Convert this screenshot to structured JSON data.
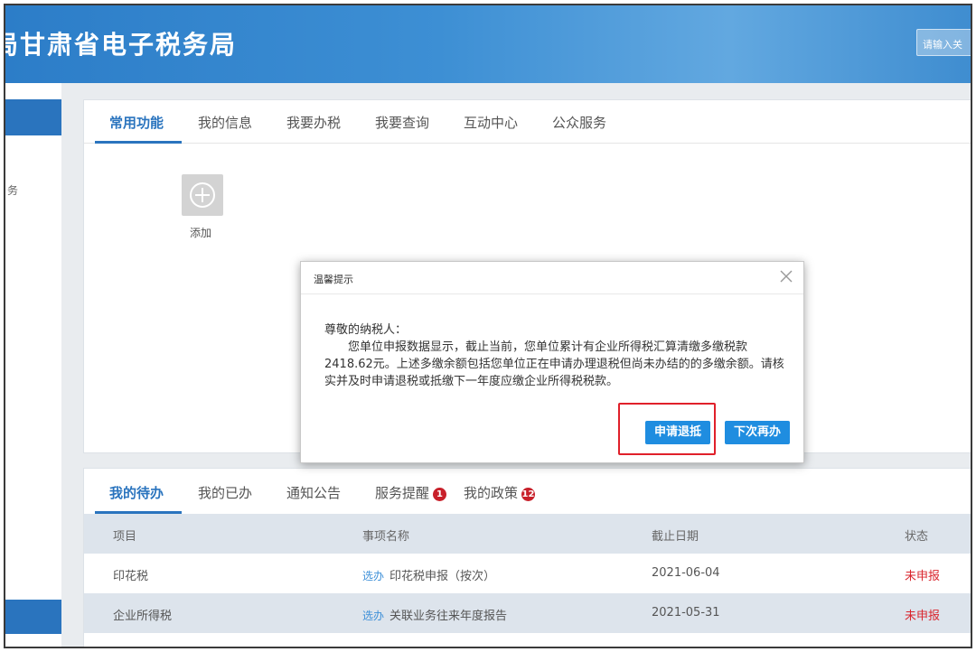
{
  "header": {
    "title": "局甘肃省电子税务局",
    "search_placeholder": "请输入关"
  },
  "sidebar": {
    "glyph": "务"
  },
  "top_tabs": [
    {
      "label": "常用功能",
      "active": true
    },
    {
      "label": "我的信息",
      "active": false
    },
    {
      "label": "我要办税",
      "active": false
    },
    {
      "label": "我要查询",
      "active": false
    },
    {
      "label": "互动中心",
      "active": false
    },
    {
      "label": "公众服务",
      "active": false
    }
  ],
  "quick_add": {
    "label": "添加",
    "icon": "plus-circle-icon"
  },
  "bottom_tabs": [
    {
      "label": "我的待办",
      "active": true
    },
    {
      "label": "我的已办",
      "active": false
    },
    {
      "label": "通知公告",
      "active": false
    },
    {
      "label": "服务提醒",
      "active": false,
      "badge": "1"
    },
    {
      "label": "我的政策",
      "active": false,
      "badge": "12"
    }
  ],
  "table": {
    "headers": [
      "项目",
      "事项名称",
      "截止日期",
      "状态"
    ],
    "rows": [
      {
        "project": "印花税",
        "action": "选办",
        "name": "印花税申报（按次）",
        "deadline": "2021-06-04",
        "status": "未申报"
      },
      {
        "project": "企业所得税",
        "action": "选办",
        "name": "关联业务往来年度报告",
        "deadline": "2021-05-31",
        "status": "未申报"
      }
    ]
  },
  "modal": {
    "title": "温馨提示",
    "greeting": "尊敬的纳税人：",
    "message": "您单位申报数据显示，截止当前，您单位累计有企业所得税汇算清缴多缴税款2418.62元。上述多缴余额包括您单位正在申请办理退税但尚未办结的的多缴余额。请核实并及时申请退税或抵缴下一年度应缴企业所得税税款。",
    "apply_button": "申请退抵",
    "later_button": "下次再办",
    "close_icon": "close-icon"
  },
  "colors": {
    "accent": "#2a74be",
    "button": "#1f8de0",
    "status_red": "#d9262e",
    "highlight": "#e0202a"
  }
}
